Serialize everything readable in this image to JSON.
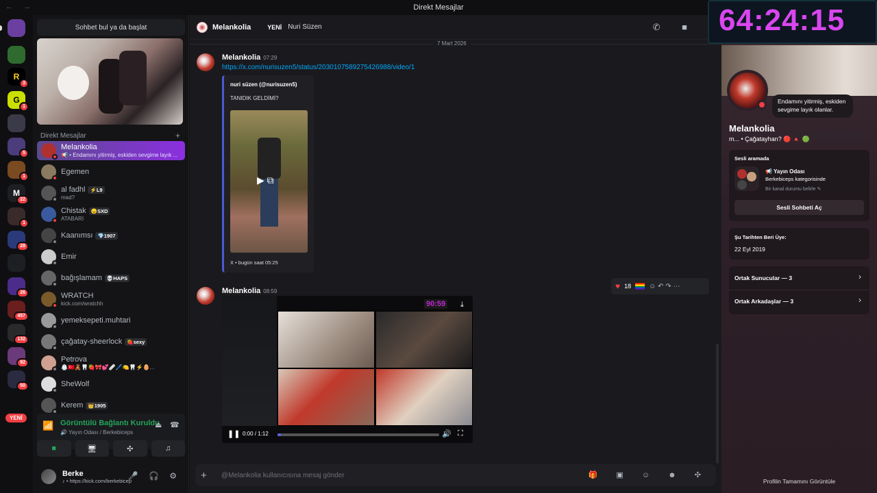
{
  "window": {
    "title": "Direkt Mesajlar",
    "nav_arrows": "← →"
  },
  "servers": [
    {
      "label": "",
      "color": "#6b3fa0",
      "badge": ""
    },
    {
      "label": "",
      "color": "#2f6b2f",
      "badge": ""
    },
    {
      "label": "R",
      "color": "#000000",
      "badge": "3"
    },
    {
      "label": "G",
      "color": "#c9e000",
      "badge": "1"
    },
    {
      "label": "",
      "color": "#3a3a48",
      "badge": ""
    },
    {
      "label": "",
      "color": "#4b3c7a",
      "badge": "5"
    },
    {
      "label": "",
      "color": "#7a4a20",
      "badge": "1"
    },
    {
      "label": "M",
      "color": "#1e1f22",
      "badge": "22"
    },
    {
      "label": "",
      "color": "#3a2a2a",
      "badge": "1"
    },
    {
      "label": "",
      "color": "#2a3a7a",
      "badge": "28"
    },
    {
      "label": "",
      "color": "#1e1f22",
      "badge": ""
    },
    {
      "label": "",
      "color": "#4b2c8a",
      "badge": "26"
    },
    {
      "label": "",
      "color": "#6a1e1e",
      "badge": "457"
    },
    {
      "label": "",
      "color": "#2a2a2a",
      "badge": "132"
    },
    {
      "label": "",
      "color": "#6a3a7a",
      "badge": "92"
    },
    {
      "label": "",
      "color": "#2a2a40",
      "badge": "50"
    }
  ],
  "yeni_badge": "YENİ",
  "sidebar": {
    "search_label": "Sohbet bul ya da başlat",
    "dm_header": "Direkt Mesajlar",
    "dm_add": "+",
    "dms": [
      {
        "name": "Melankolia",
        "sub": "📢 • Endamını yitirmiş, eskiden sevgime layık ...",
        "tag": "",
        "color": "#b03030",
        "status": "dnd"
      },
      {
        "name": "Egemen",
        "sub": "",
        "tag": "",
        "color": "#8a7a60",
        "status": "dnd"
      },
      {
        "name": "al fadhl",
        "sub": "mad?",
        "tag": "⚡L9",
        "color": "#555555",
        "status": "offline"
      },
      {
        "name": "Chistak",
        "sub": "ATABARI",
        "tag": "😠SXD",
        "color": "#3a5aa0",
        "status": "dnd"
      },
      {
        "name": "Kaanımsı",
        "sub": "",
        "tag": "💎1907",
        "color": "#444444",
        "status": "offline"
      },
      {
        "name": "Emir",
        "sub": "",
        "tag": "",
        "color": "#cccccc",
        "status": "offline"
      },
      {
        "name": "bağışlamam",
        "sub": "",
        "tag": "💀HAPS",
        "color": "#666666",
        "status": "offline"
      },
      {
        "name": "WRATCH",
        "sub": "kick.com/wratchh",
        "tag": "",
        "color": "#7a5a2a",
        "status": "dnd"
      },
      {
        "name": "yemeksepeti.muhtari",
        "sub": "",
        "tag": "",
        "color": "#999999",
        "status": "offline"
      },
      {
        "name": "çağatay-sheerlock",
        "sub": "",
        "tag": "🍓sexy",
        "color": "#777777",
        "status": "offline"
      },
      {
        "name": "Petrova",
        "sub": "🥼🇹🇷🧸🦷🍓🎀💕🩹🖊️🍋🦷⚡🥚...",
        "tag": "",
        "color": "#d0a090",
        "status": "offline"
      },
      {
        "name": "SheWolf",
        "sub": "",
        "tag": "",
        "color": "#dddddd",
        "status": "offline"
      },
      {
        "name": "Kerem",
        "sub": "",
        "tag": "👑1905",
        "color": "#555555",
        "status": "offline"
      }
    ],
    "voice": {
      "connected": "Görüntülü Bağlantı Kuruldu",
      "channel": "🔊 Yayın Odası / Berkebiceps",
      "icons": "⏏ ☎"
    },
    "voice_buttons": {
      "camera": "■",
      "screen": "🖥",
      "activities": "✣",
      "soundboard": "♫"
    },
    "user": {
      "name": "Berke",
      "status": "♪ • https://kick.com/berkebicep",
      "controls": "🎤 🎧 ⚙"
    }
  },
  "chat": {
    "header_name": "Melankolia",
    "header_new": "YENİ",
    "header_user": "Nuri Süzen",
    "header_icons": "✆ ■",
    "date_divider": "7 Mart 2026",
    "messages": [
      {
        "author": "Melankolia",
        "time": "07:29",
        "link": "https://x.com/nurisuzen5/status/2030107589275426988/video/1",
        "embed": {
          "author": "nuri süzen (@nurisuzen5)",
          "text": "TANIDIK GELDİMİ?",
          "footer": "X • bugün saat 05:25",
          "play": "▶ ⧉"
        }
      },
      {
        "author": "Melankolia",
        "time": "08:59",
        "video": {
          "overlay_timer": "90:59",
          "current": "0:00",
          "duration": "1:12",
          "progress": 0.02,
          "download": "⤓",
          "pause": "❚❚",
          "volume": "🔊",
          "fullscreen": "⛶"
        }
      }
    ],
    "reactions": {
      "count": "18",
      "icons": "☺ ↶ ↷ ⋯"
    },
    "input": {
      "placeholder": "@Melankolia kullanıcısına mesaj gönder",
      "plus": "+",
      "tools": "🎁 ▣ ☺ ☻ ✣"
    }
  },
  "profile": {
    "bubble": "Endamını yitirmiş, eskiden sevgime layık olanlar.",
    "name": "Melankolia",
    "status": "m... • Çağatayhan? 🔴 🔺 🟢",
    "voice_card": {
      "label": "Sesli aramada",
      "room": "📢 Yayın Odası",
      "category": "Berkebiceps kategorisinde",
      "set": "Bir kanal durumu belirle ✎",
      "button": "Sesli Sohbeti Aç"
    },
    "member_card": {
      "label": "Şu Tarihten Beri Üye:",
      "value": "22 Eyl 2019"
    },
    "servers_row": "Ortak Sunucular — 3",
    "friends_row": "Ortak Arkadaşlar — 3",
    "arrow": "›",
    "footer": "Profilin Tamamını Görüntüle"
  },
  "stream_timer": "64:24:15"
}
